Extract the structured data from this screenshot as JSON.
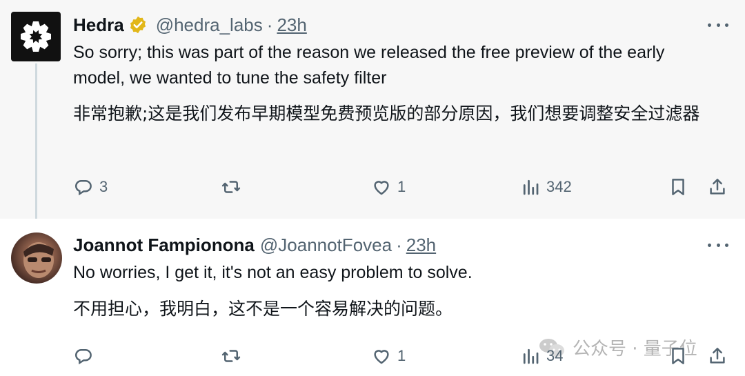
{
  "tweet1": {
    "author_name": "Hedra",
    "handle": "@hedra_labs",
    "separator": "·",
    "time": "23h",
    "text_en": "So sorry; this was part of the reason we released the free preview of the early model, we wanted to tune the safety filter",
    "text_zh": "非常抱歉;这是我们发布早期模型免费预览版的部分原因，我们想要调整安全过滤器",
    "replies": "3",
    "likes": "1",
    "views": "342"
  },
  "tweet2": {
    "author_name": "Joannot Fampiononа",
    "handle": "@JoannotFovea",
    "separator": "·",
    "time": "23h",
    "text_en": "No worries, I get it, it's not an easy problem to solve.",
    "text_zh": "不用担心，我明白，这不是一个容易解决的问题。",
    "likes": "1",
    "views": "34"
  },
  "watermark": {
    "text": "公众号 · 量子位"
  },
  "icons": {
    "verified": "verified-badge-icon",
    "reply": "reply-icon",
    "retweet": "retweet-icon",
    "like": "heart-icon",
    "views": "views-chart-icon",
    "bookmark": "bookmark-icon",
    "share": "share-icon",
    "more": "more-dots-icon"
  },
  "colors": {
    "verified_gold": "#e2b719",
    "secondary_text": "#536471",
    "thread_line": "#cfd9de"
  }
}
